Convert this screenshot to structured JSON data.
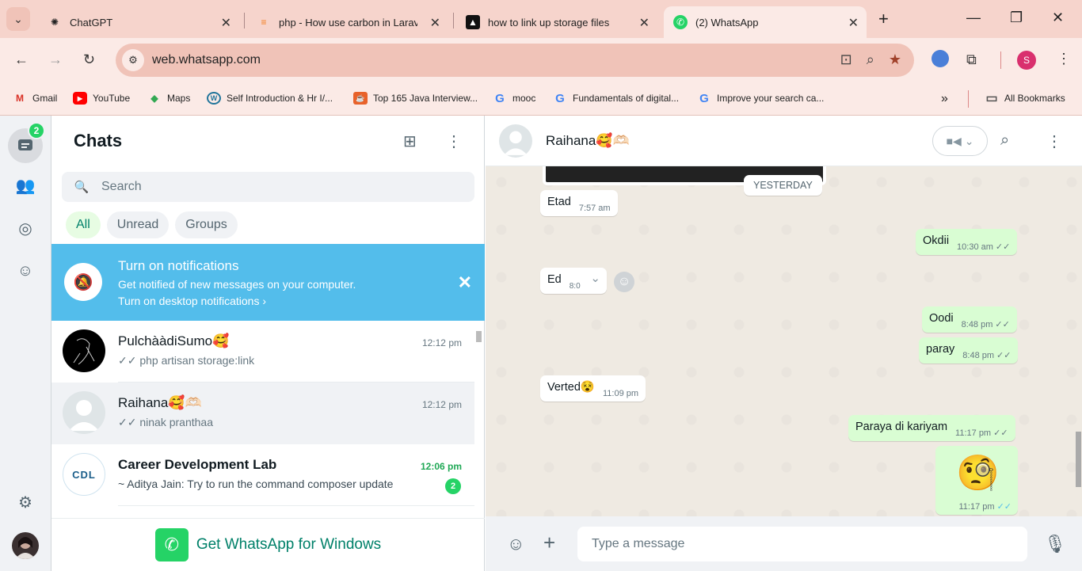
{
  "browser": {
    "tab_list_icon": "chevron-down-icon",
    "tabs": [
      {
        "title": "ChatGPT",
        "icon": "chatgpt-icon"
      },
      {
        "title": "php - How use carbon in Laravel",
        "icon": "stackoverflow-icon"
      },
      {
        "title": "how to link up storage files",
        "icon": "vercel-icon"
      },
      {
        "title": "(2) WhatsApp",
        "icon": "whatsapp-icon",
        "active": true
      }
    ],
    "url": "web.whatsapp.com",
    "profile_initial": "S",
    "bookmarks": [
      {
        "label": "Gmail",
        "icon": "gmail-icon"
      },
      {
        "label": "YouTube",
        "icon": "youtube-icon"
      },
      {
        "label": "Maps",
        "icon": "maps-icon"
      },
      {
        "label": "Self Introduction & Hr I/...",
        "icon": "wordpress-icon"
      },
      {
        "label": "Top 165 Java Interview...",
        "icon": "java-icon"
      },
      {
        "label": "mooc",
        "icon": "google-icon"
      },
      {
        "label": "Fundamentals of digital...",
        "icon": "google-icon"
      },
      {
        "label": "Improve your search ca...",
        "icon": "google-icon"
      }
    ],
    "all_bookmarks": "All Bookmarks"
  },
  "rail": {
    "chats_badge": "2"
  },
  "sidebar": {
    "title": "Chats",
    "search_placeholder": "Search",
    "filters": [
      "All",
      "Unread",
      "Groups"
    ],
    "notification": {
      "title": "Turn on notifications",
      "subtitle": "Get notified of new messages on your computer.",
      "link": "Turn on desktop notifications ›"
    },
    "chats": [
      {
        "name": "PulchààdiSumo🥰",
        "time": "12:12 pm",
        "last": "✓✓ php artisan storage:link"
      },
      {
        "name": "Raihana🥰🫶🏻",
        "time": "12:12 pm",
        "last": "✓✓ ninak pranthaa"
      },
      {
        "name": "Career Development Lab",
        "time": "12:06 pm",
        "last": "~ Aditya Jain: Try to run the command composer update",
        "unread": "2",
        "avatar_text": "CDL"
      }
    ],
    "get_app": "Get WhatsApp for Windows"
  },
  "conversation": {
    "contact_name": "Raihana🥰🫶🏻",
    "day_label": "YESTERDAY",
    "messages": [
      {
        "dir": "in",
        "text": "Etad",
        "time": "7:57 am"
      },
      {
        "dir": "out",
        "text": "Okdii",
        "time": "10:30 am"
      },
      {
        "dir": "in",
        "text": "Ed",
        "time": "8:0"
      },
      {
        "dir": "out",
        "text": "Oodi",
        "time": "8:48 pm"
      },
      {
        "dir": "out",
        "text": "paray",
        "time": "8:48 pm"
      },
      {
        "dir": "in",
        "text": "Verted😵",
        "time": "11:09 pm"
      },
      {
        "dir": "out",
        "text": "Paraya di kariyam",
        "time": "11:17 pm"
      },
      {
        "dir": "out",
        "sticker": "🧐",
        "time": "11:17 pm"
      }
    ],
    "compose_placeholder": "Type a message"
  },
  "colors": {
    "accent": "#25d366",
    "notification_bg": "#53bdeb",
    "outgoing_bubble": "#d9fdd3",
    "chrome_bg": "#f6d4cc"
  }
}
